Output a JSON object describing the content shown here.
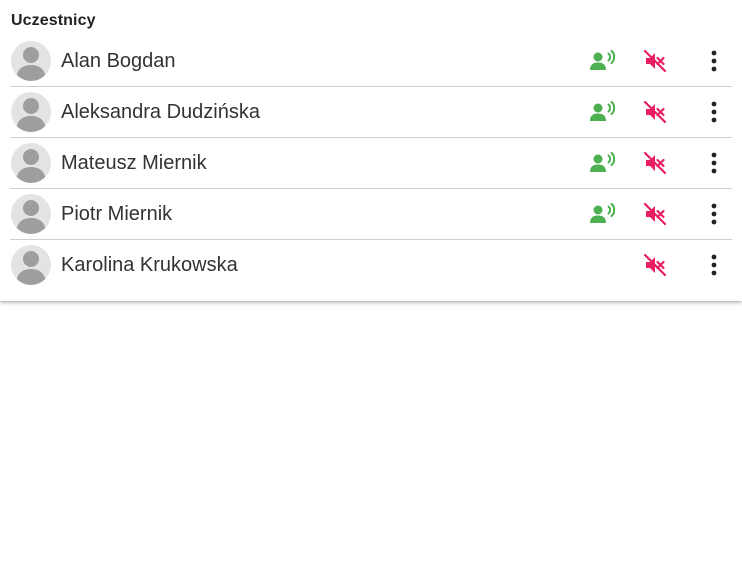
{
  "panel": {
    "title": "Uczestnicy"
  },
  "colors": {
    "speaking": "#4caf50",
    "muted": "#e91e63",
    "menu": "#222222",
    "avatar_bg": "#e3e3e3",
    "avatar_fg": "#9e9e9e"
  },
  "participants": [
    {
      "name": "Alan Bogdan",
      "icons": [
        "person-voice-icon",
        "volume-off-icon",
        "more-vert-icon"
      ]
    },
    {
      "name": "Aleksandra Dudzińska",
      "icons": [
        "person-voice-icon",
        "volume-off-icon",
        "more-vert-icon"
      ]
    },
    {
      "name": "Mateusz Miernik",
      "icons": [
        "person-voice-icon",
        "volume-off-icon",
        "more-vert-icon"
      ]
    },
    {
      "name": "Piotr Miernik",
      "icons": [
        "person-voice-icon",
        "volume-off-icon",
        "more-vert-icon"
      ]
    },
    {
      "name": "Karolina Krukowska",
      "icons": [
        "volume-off-icon",
        "more-vert-icon"
      ]
    }
  ]
}
